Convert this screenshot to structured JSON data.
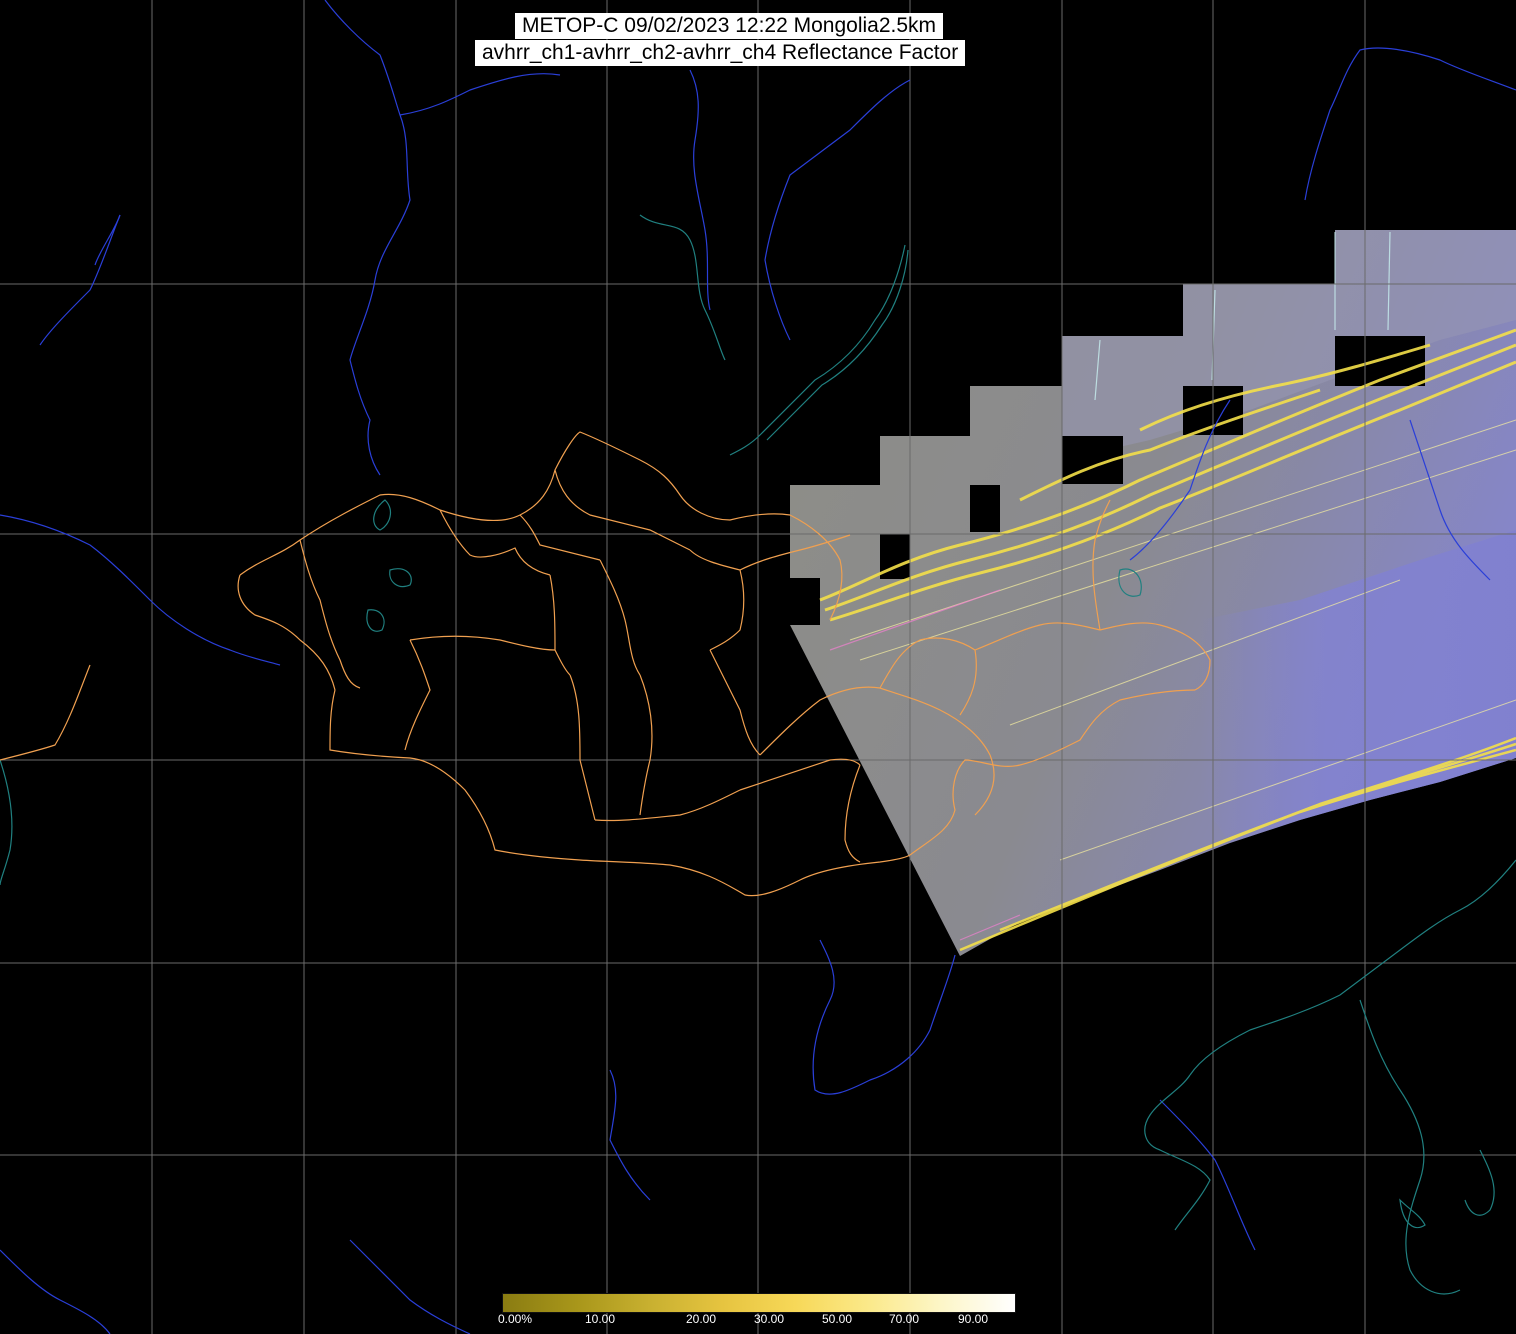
{
  "title": {
    "line1": "METOP-C 09/02/2023 12:22 Mongolia2.5km",
    "line2": "avhrr_ch1-avhrr_ch2-avhrr_ch4 Reflectance Factor"
  },
  "colorbar": {
    "labels": [
      "0.00%",
      "10.00",
      "20.00",
      "30.00",
      "50.00",
      "70.00",
      "90.00"
    ],
    "colors": [
      "#8a7c12",
      "#a8961a",
      "#c8b030",
      "#e6c440",
      "#f7d858",
      "#fbe98a",
      "#fdf6c8",
      "#ffffff"
    ]
  },
  "map": {
    "region": "Mongolia",
    "colors": {
      "background": "#000000",
      "graticule": "#6a6a6a",
      "admin_boundaries": "#f0a050",
      "rivers": "#2a3fd8",
      "coastlines": "#208080",
      "swath_base": "#8c8c84",
      "swath_cloud": "#8a8ad0",
      "swath_streak": "#f4e04a"
    }
  }
}
